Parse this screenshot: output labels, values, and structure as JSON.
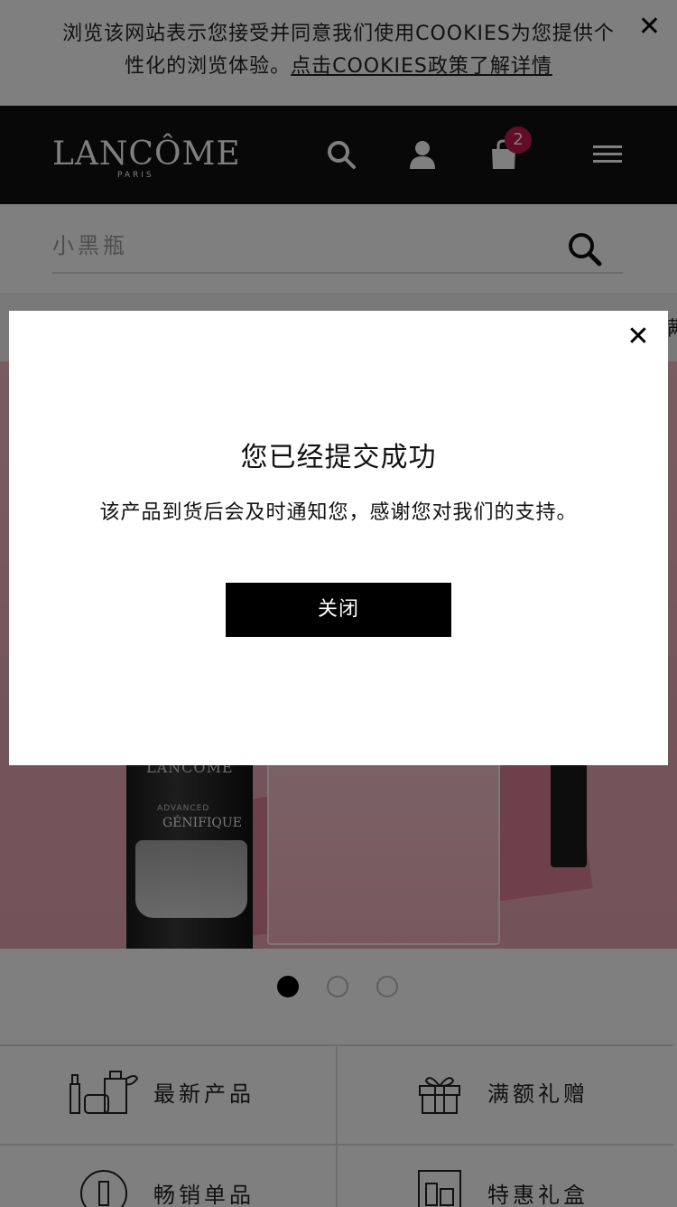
{
  "cookie_banner": {
    "text": "浏览该网站表示您接受并同意我们使用COOKIES为您提供个性化的浏览体验。",
    "link": "点击COOKIES政策了解详情",
    "close_icon": "close-icon"
  },
  "header": {
    "logo": "LANCÔME",
    "logo_sub": "PARIS",
    "icons": [
      "search-icon",
      "account-icon",
      "shopping-bag-icon",
      "menu-icon"
    ],
    "cart_count": "2"
  },
  "search": {
    "placeholder": "小黑瓶"
  },
  "promo": {
    "text": "满"
  },
  "hero": {
    "bottle_brand": "LANCÔME",
    "bottle_line": "ADVANCED",
    "bottle_name": "GÉNIFIQUE"
  },
  "carousel": {
    "slides": 3,
    "active_index": 0
  },
  "categories": [
    {
      "label": "最新产品",
      "icon": "new-products-icon"
    },
    {
      "label": "满额礼赠",
      "icon": "gift-icon"
    },
    {
      "label": "畅销单品",
      "icon": "bestseller-icon"
    },
    {
      "label": "特惠礼盒",
      "icon": "gift-box-icon"
    }
  ],
  "modal": {
    "title": "您已经提交成功",
    "message": "该产品到货后会及时通知您，感谢您对我们的支持。",
    "button": "关闭"
  },
  "colors": {
    "header_bg": "#111111",
    "badge": "#c5184e",
    "button_bg": "#000000"
  }
}
